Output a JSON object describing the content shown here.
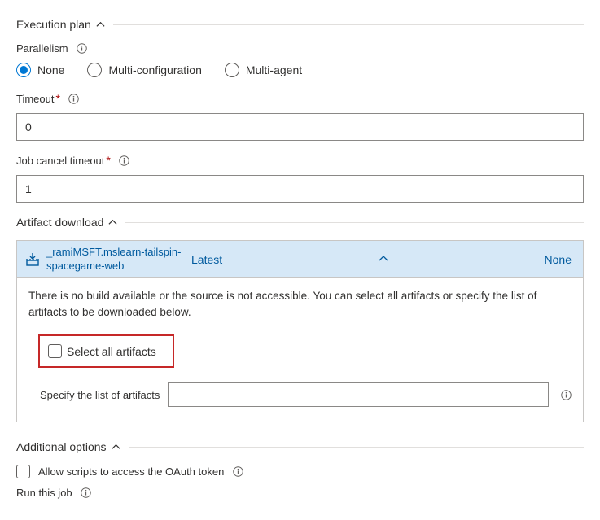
{
  "sections": {
    "execution_plan": "Execution plan",
    "artifact_download": "Artifact download",
    "additional_options": "Additional options"
  },
  "parallelism": {
    "label": "Parallelism",
    "options": {
      "none": "None",
      "multi_config": "Multi-configuration",
      "multi_agent": "Multi-agent"
    },
    "selected": "none"
  },
  "timeout": {
    "label": "Timeout",
    "value": "0"
  },
  "job_cancel_timeout": {
    "label": "Job cancel timeout",
    "value": "1"
  },
  "artifact": {
    "source_name": "_ramiMSFT.mslearn-tailspin-spacegame-web",
    "version_label": "Latest",
    "none_label": "None",
    "message": "There is no build available or the source is not accessible. You can select all artifacts or specify the list of artifacts to be downloaded below.",
    "select_all_label": "Select all artifacts",
    "specify_label": "Specify the list of artifacts",
    "specify_value": ""
  },
  "additional": {
    "allow_scripts_label": "Allow scripts to access the OAuth token",
    "run_this_job_label": "Run this job"
  }
}
